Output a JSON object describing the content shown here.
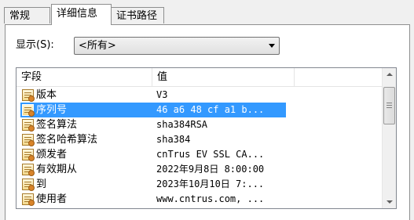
{
  "tabs": [
    {
      "label": "常规"
    },
    {
      "label": "详细信息"
    },
    {
      "label": "证书路径"
    }
  ],
  "show": {
    "label": "显示(S):",
    "selected": "<所有>"
  },
  "columns": {
    "field": "字段",
    "value": "值"
  },
  "rows": [
    {
      "field": "版本",
      "value": "V3"
    },
    {
      "field": "序列号",
      "value": "46 a6 48 cf a1 b..."
    },
    {
      "field": "签名算法",
      "value": "sha384RSA"
    },
    {
      "field": "签名哈希算法",
      "value": "sha384"
    },
    {
      "field": "颁发者",
      "value": "cnTrus EV SSL CA..."
    },
    {
      "field": "有效期从",
      "value": "2022年9月8日 8:00:00"
    },
    {
      "field": "到",
      "value": "2023年10月10日 7:..."
    },
    {
      "field": "使用者",
      "value": "www.cntrus.com, ..."
    }
  ],
  "selected_row": 1,
  "colors": {
    "selection": "#3399ff",
    "panel": "#ffffff",
    "window": "#f0f0f0"
  }
}
